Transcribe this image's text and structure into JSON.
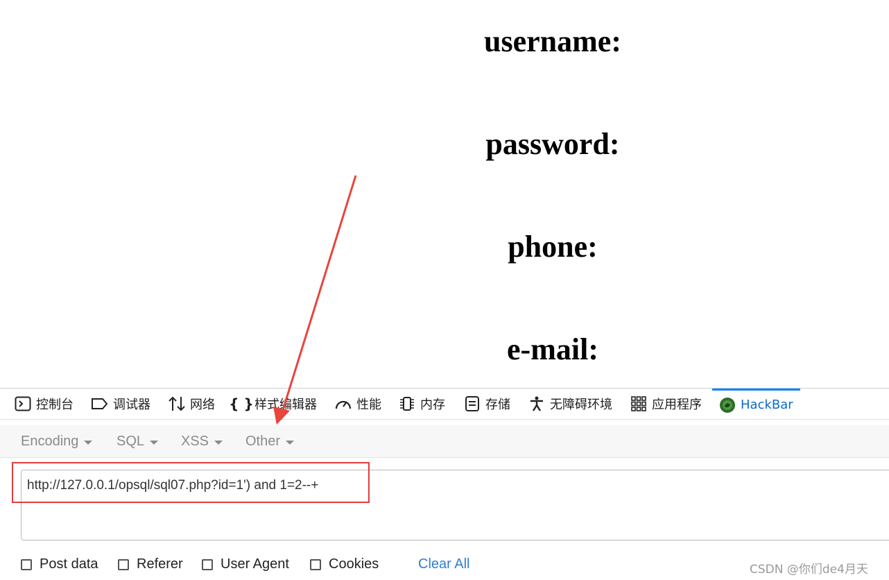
{
  "page": {
    "labels": [
      "username:",
      "password:",
      "phone:",
      "e-mail:"
    ]
  },
  "devtools": {
    "tabs": [
      {
        "label": "控制台",
        "icon": "console-icon"
      },
      {
        "label": "调试器",
        "icon": "debugger-icon"
      },
      {
        "label": "网络",
        "icon": "network-icon"
      },
      {
        "label": "样式编辑器",
        "icon": "style-editor-icon"
      },
      {
        "label": "性能",
        "icon": "performance-icon"
      },
      {
        "label": "内存",
        "icon": "memory-icon"
      },
      {
        "label": "存储",
        "icon": "storage-icon"
      },
      {
        "label": "无障碍环境",
        "icon": "accessibility-icon"
      },
      {
        "label": "应用程序",
        "icon": "application-icon"
      },
      {
        "label": "HackBar",
        "icon": "hackbar-icon"
      }
    ],
    "active_tab": "HackBar",
    "accent_color": "#0a84ff"
  },
  "hackbar": {
    "menus": [
      "Encoding",
      "SQL",
      "XSS",
      "Other"
    ],
    "url": "http://127.0.0.1/opsql/sql07.php?id=1') and 1=2--+",
    "options": [
      "Post data",
      "Referer",
      "User Agent",
      "Cookies"
    ],
    "clear_all": "Clear All",
    "highlight_color": "#e23c3c"
  },
  "watermark": "CSDN @你们de4月天"
}
